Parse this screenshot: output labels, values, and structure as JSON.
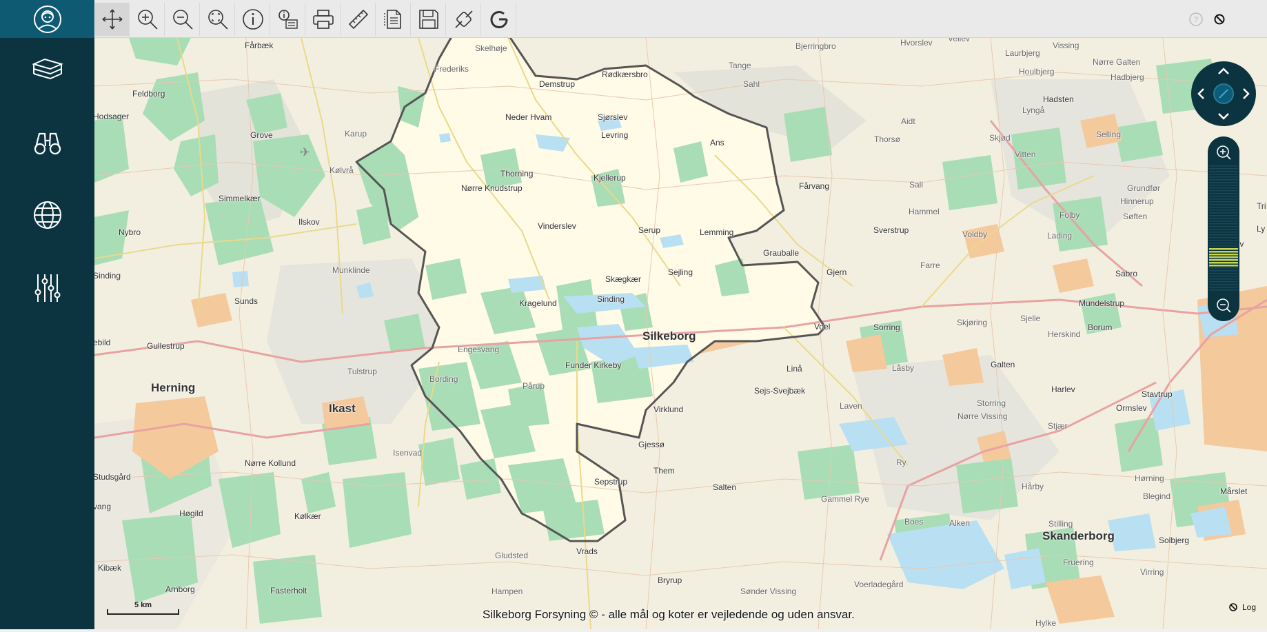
{
  "app": {
    "attribution": "Silkeborg Forsyning © - alle mål og koter er vejledende og uden ansvar.",
    "scale_label": "5 km",
    "log_label": "Log"
  },
  "colors": {
    "sidebar_bg": "#0c3340",
    "logo_bg": "#0e5a73",
    "toolbar_bg": "#eaeaea",
    "forest": "#a8ddb5",
    "water": "#b9dff3",
    "urban": "#f4c99c",
    "highlight_area": "#fffbe6",
    "boundary": "#555555",
    "zoom_level": "#c7d650"
  },
  "sidebar": {
    "items": [
      {
        "icon": "user-profile-icon"
      },
      {
        "icon": "layers-icon"
      },
      {
        "icon": "binoculars-icon"
      },
      {
        "icon": "globe-icon"
      },
      {
        "icon": "sliders-icon"
      }
    ]
  },
  "toolbar": {
    "tools": [
      {
        "icon": "pan-icon"
      },
      {
        "icon": "zoom-in-icon"
      },
      {
        "icon": "zoom-out-icon"
      },
      {
        "icon": "zoom-extent-icon"
      },
      {
        "icon": "info-icon"
      },
      {
        "icon": "identify-icon"
      },
      {
        "icon": "print-icon"
      },
      {
        "icon": "measure-icon"
      },
      {
        "icon": "document-icon"
      },
      {
        "icon": "save-icon"
      },
      {
        "icon": "link-icon"
      },
      {
        "icon": "google-icon"
      }
    ],
    "right_icons": [
      {
        "icon": "help-icon"
      },
      {
        "icon": "block-icon"
      }
    ]
  },
  "zoom": {
    "level_fraction": 0.27
  },
  "places": {
    "farbaek": "Fårbæk",
    "skelhoje": "Skelhøje",
    "frederiks": "Frederiks",
    "demstrup": "Demstrup",
    "rodkaersbro": "Rødkærsbro",
    "tange": "Tange",
    "bjerringbro": "Bjerringbro",
    "hvorslev": "Hvorslev",
    "vellev": "Vellev",
    "laurbjerg": "Laurbjerg",
    "vissing": "Vissing",
    "norre_galten": "Nørre Galten",
    "hadbjerg": "Hadbjerg",
    "houlbjerg": "Houlbjerg",
    "hadsten": "Hadsten",
    "feldborg": "Feldborg",
    "hodsager": "Hodsager",
    "sahl": "Sahl",
    "neder_hvam": "Neder Hvam",
    "sjorslev": "Sjørslev",
    "aidt": "Aidt",
    "lynga": "Lyngå",
    "grove": "Grove",
    "karup": "Karup",
    "levring": "Levring",
    "ans": "Ans",
    "thorso": "Thorsø",
    "skjod": "Skjød",
    "selling": "Selling",
    "vitten": "Vitten",
    "kolvra": "Kølvrå",
    "thorning": "Thorning",
    "kjellerup": "Kjellerup",
    "sall": "Sall",
    "simmelkaer": "Simmelkær",
    "norre_knudstrup": "Nørre Knudstrup",
    "farvang": "Fårvang",
    "grundfor": "Grundfør",
    "hinnerup": "Hinnerup",
    "hammel": "Hammel",
    "folby": "Folby",
    "soften": "Søften",
    "nybro": "Nybro",
    "vinderslev": "Vinderslev",
    "ilskov": "Ilskov",
    "serup": "Serup",
    "lemming": "Lemming",
    "sverstrup": "Sverstrup",
    "voldby": "Voldby",
    "lading": "Lading",
    "elev": "Elev",
    "grauballe": "Grauballe",
    "munklinde": "Munklinde",
    "sejling": "Sejling",
    "farre": "Farre",
    "gjern": "Gjern",
    "sabro": "Sabro",
    "sinding_west": "Sinding",
    "skaegkaer": "Skægkær",
    "sunds": "Sunds",
    "sinding": "Sinding",
    "kragelund": "Kragelund",
    "mundelstrup": "Mundelstrup",
    "sjelle": "Sjelle",
    "borum": "Borum",
    "voel": "Voel",
    "sorring": "Sorring",
    "skjoring": "Skjøring",
    "herskind": "Herskind",
    "silkeborg": "Silkeborg",
    "ebild": "ebild",
    "gullestrup": "Gullestrup",
    "engesvang": "Engesvang",
    "funder_kirkeby": "Funder Kirkeby",
    "lina": "Linå",
    "lasby": "Låsby",
    "galten": "Galten",
    "tulstrup": "Tulstrup",
    "bording": "Bording",
    "herning": "Herning",
    "parup": "Pårup",
    "sejs_svejbaek": "Sejs-Svejbæk",
    "harlev": "Harlev",
    "stavtrup": "Stavtrup",
    "laven": "Laven",
    "storring": "Storring",
    "ikast": "Ikast",
    "ormslev": "Ormslev",
    "virklund": "Virklund",
    "norre_vissing": "Nørre Vissing",
    "stjaer": "Stjær",
    "isenvad": "Isenvad",
    "gjesso": "Gjessø",
    "norre_kollund": "Nørre Kollund",
    "them": "Them",
    "ry": "Ry",
    "studsgard": "Studsgård",
    "sepstrup": "Sepstrup",
    "horning": "Hørning",
    "harby": "Hårby",
    "salten": "Salten",
    "marslet": "Mårslet",
    "vang": "vang",
    "blegind": "Blegind",
    "hogild": "Høgild",
    "kolkaer": "Kølkær",
    "gammel_rye": "Gammel Rye",
    "boes": "Boes",
    "alken": "Alken",
    "stilling": "Stilling",
    "skanderborg": "Skanderborg",
    "solbjerg": "Solbjerg",
    "vrads": "Vrads",
    "gludsted": "Gludsted",
    "fruering": "Fruering",
    "kibaek": "Kibæk",
    "virring": "Virring",
    "arnborg": "Arnborg",
    "fasterholt": "Fasterholt",
    "bryrup": "Bryrup",
    "hampen": "Hampen",
    "sonder_vissing": "Sønder Vissing",
    "voerladegard": "Voerladegård",
    "hylke": "Hylke",
    "tri": "Tri",
    "ly": "Ly"
  }
}
